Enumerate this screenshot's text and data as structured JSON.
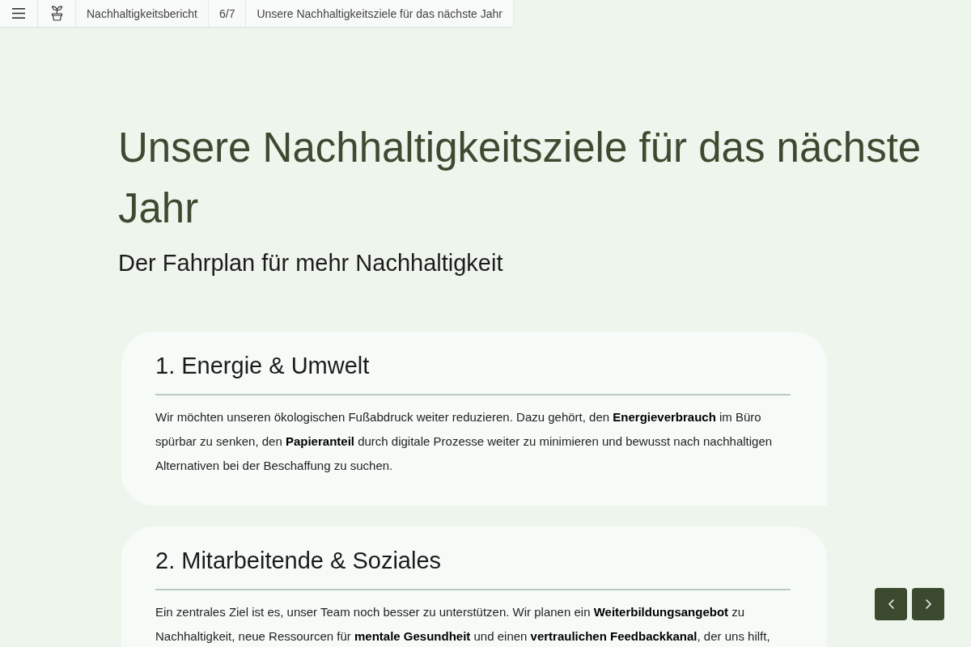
{
  "topbar": {
    "report_title": "Nachhaltigkeitsbericht",
    "page_indicator": "6/7",
    "page_title": "Unsere Nachhaltigkeitsziele für das nächste Jahr"
  },
  "heading": "Unsere Nachhaltigkeitsziele für das nächste Jahr",
  "subheading": "Der Fahrplan für mehr Nachhaltigkeit",
  "sections": [
    {
      "title": "1. Energie & Umwelt",
      "body": "Wir möchten unseren ökologischen Fußabdruck weiter reduzieren. Dazu gehört, den **Energieverbrauch** im Büro spürbar zu senken, den **Papieranteil** durch digitale Prozesse weiter zu minimieren und bewusst nach nachhaltigen Alternativen bei der Beschaffung zu suchen."
    },
    {
      "title": "2. Mitarbeitende & Soziales",
      "body": "Ein zentrales Ziel ist es, unser Team noch besser zu unterstützen. Wir planen ein **Weiterbildungsangebot** zu Nachhaltigkeit, neue Ressourcen für **mentale Gesundheit** und einen **vertraulichen Feedbackkanal**, der uns hilft,"
    }
  ]
}
